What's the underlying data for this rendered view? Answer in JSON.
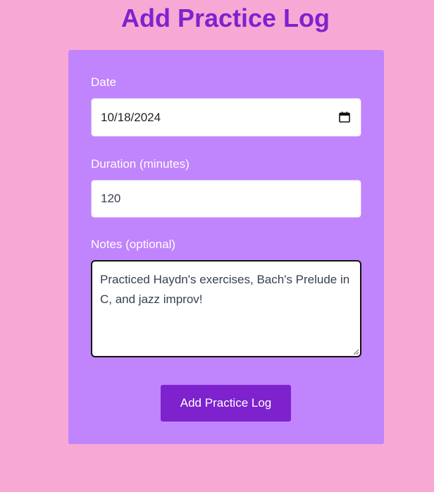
{
  "page": {
    "title": "Add Practice Log"
  },
  "form": {
    "date": {
      "label": "Date",
      "value": "10/18/2024"
    },
    "duration": {
      "label": "Duration (minutes)",
      "value": "120"
    },
    "notes": {
      "label": "Notes (optional)",
      "value": "Practiced Haydn's exercises, Bach's Prelude in C, and jazz improv!"
    },
    "submit_label": "Add Practice Log"
  },
  "colors": {
    "background": "#f8a8d4",
    "card": "#c084fc",
    "accent": "#7e22ce",
    "label_text": "#ffffff"
  },
  "icons": {
    "date_picker": "calendar-icon",
    "textarea_resize": "resize-grip-icon"
  }
}
